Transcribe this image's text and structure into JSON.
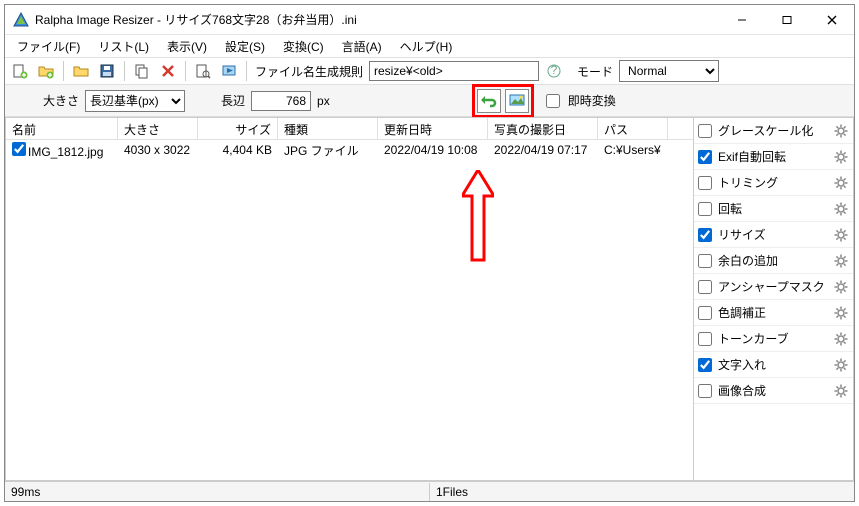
{
  "title": "Ralpha Image Resizer - リサイズ768文字28（お弁当用）.ini",
  "menus": [
    "ファイル(F)",
    "リスト(L)",
    "表示(V)",
    "設定(S)",
    "変換(C)",
    "言語(A)",
    "ヘルプ(H)"
  ],
  "toolbar": {
    "filename_rule_label": "ファイル名生成規則",
    "filename_rule_value": "resize¥<old>",
    "mode_label": "モード",
    "mode_value": "Normal"
  },
  "toolbar2": {
    "size_label": "大きさ",
    "size_basis": "長辺基準(px)",
    "side_label": "長辺",
    "side_value": "768",
    "unit": "px",
    "instant_label": "即時変換"
  },
  "columns": [
    "名前",
    "大きさ",
    "サイズ",
    "種類",
    "更新日時",
    "写真の撮影日",
    "パス"
  ],
  "row": {
    "name": "IMG_1812.jpg",
    "wh": "4030 x 3022",
    "kb": "4,404 KB",
    "type": "JPG ファイル",
    "mtime": "2022/04/19 10:08",
    "shot": "2022/04/19 07:17",
    "path": "C:¥Users¥"
  },
  "side_items": [
    {
      "label": "グレースケール化",
      "checked": false
    },
    {
      "label": "Exif自動回転",
      "checked": true
    },
    {
      "label": "トリミング",
      "checked": false
    },
    {
      "label": "回転",
      "checked": false
    },
    {
      "label": "リサイズ",
      "checked": true
    },
    {
      "label": "余白の追加",
      "checked": false
    },
    {
      "label": "アンシャープマスク",
      "checked": false
    },
    {
      "label": "色調補正",
      "checked": false
    },
    {
      "label": "トーンカーブ",
      "checked": false
    },
    {
      "label": "文字入れ",
      "checked": true
    },
    {
      "label": "画像合成",
      "checked": false
    }
  ],
  "status": {
    "left": "99ms",
    "right": "1Files"
  }
}
